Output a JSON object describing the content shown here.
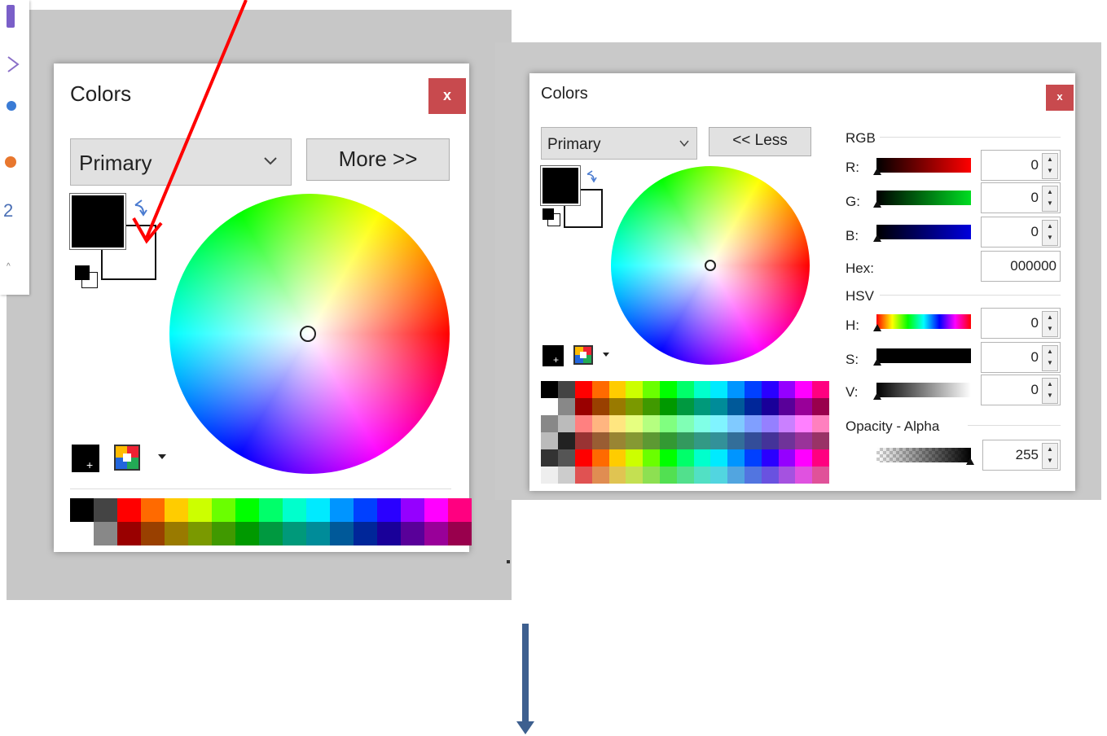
{
  "left_panel": {
    "title": "Colors",
    "close_label": "x",
    "mode_dropdown": "Primary",
    "more_button": "More >>"
  },
  "right_panel": {
    "title": "Colors",
    "close_label": "x",
    "mode_dropdown": "Primary",
    "less_button": "<< Less",
    "rgb_heading": "RGB",
    "r_label": "R:",
    "g_label": "G:",
    "b_label": "B:",
    "r_value": "0",
    "g_value": "0",
    "b_value": "0",
    "hex_label": "Hex:",
    "hex_value": "000000",
    "hsv_heading": "HSV",
    "h_label": "H:",
    "s_label": "S:",
    "v_label": "V:",
    "h_value": "0",
    "s_value": "0",
    "v_value": "0",
    "opacity_heading": "Opacity - Alpha",
    "alpha_value": "255"
  },
  "colors": {
    "primary": "#000000",
    "secondary": "#ffffff",
    "close_button": "#c84a4e",
    "red_arrow": "#ff0000",
    "blue_arrow": "#3d5f8f"
  },
  "icons": {
    "swap": "swap-icon",
    "reset": "reset-colors-icon",
    "add_to_palette": "add-to-palette-icon",
    "palette_menu": "palette-menu-icon",
    "dropdown_chevron": "chevron-down-icon"
  }
}
